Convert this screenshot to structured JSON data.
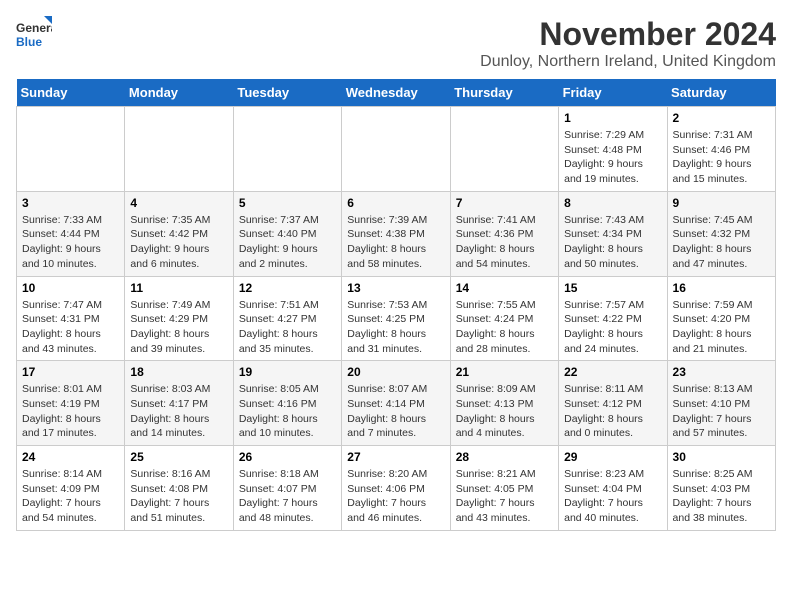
{
  "logo": {
    "general": "General",
    "blue": "Blue"
  },
  "title": {
    "month": "November 2024",
    "location": "Dunloy, Northern Ireland, United Kingdom"
  },
  "weekdays": [
    "Sunday",
    "Monday",
    "Tuesday",
    "Wednesday",
    "Thursday",
    "Friday",
    "Saturday"
  ],
  "weeks": [
    [
      {
        "date": "",
        "info": ""
      },
      {
        "date": "",
        "info": ""
      },
      {
        "date": "",
        "info": ""
      },
      {
        "date": "",
        "info": ""
      },
      {
        "date": "",
        "info": ""
      },
      {
        "date": "1",
        "info": "Sunrise: 7:29 AM\nSunset: 4:48 PM\nDaylight: 9 hours and 19 minutes."
      },
      {
        "date": "2",
        "info": "Sunrise: 7:31 AM\nSunset: 4:46 PM\nDaylight: 9 hours and 15 minutes."
      }
    ],
    [
      {
        "date": "3",
        "info": "Sunrise: 7:33 AM\nSunset: 4:44 PM\nDaylight: 9 hours and 10 minutes."
      },
      {
        "date": "4",
        "info": "Sunrise: 7:35 AM\nSunset: 4:42 PM\nDaylight: 9 hours and 6 minutes."
      },
      {
        "date": "5",
        "info": "Sunrise: 7:37 AM\nSunset: 4:40 PM\nDaylight: 9 hours and 2 minutes."
      },
      {
        "date": "6",
        "info": "Sunrise: 7:39 AM\nSunset: 4:38 PM\nDaylight: 8 hours and 58 minutes."
      },
      {
        "date": "7",
        "info": "Sunrise: 7:41 AM\nSunset: 4:36 PM\nDaylight: 8 hours and 54 minutes."
      },
      {
        "date": "8",
        "info": "Sunrise: 7:43 AM\nSunset: 4:34 PM\nDaylight: 8 hours and 50 minutes."
      },
      {
        "date": "9",
        "info": "Sunrise: 7:45 AM\nSunset: 4:32 PM\nDaylight: 8 hours and 47 minutes."
      }
    ],
    [
      {
        "date": "10",
        "info": "Sunrise: 7:47 AM\nSunset: 4:31 PM\nDaylight: 8 hours and 43 minutes."
      },
      {
        "date": "11",
        "info": "Sunrise: 7:49 AM\nSunset: 4:29 PM\nDaylight: 8 hours and 39 minutes."
      },
      {
        "date": "12",
        "info": "Sunrise: 7:51 AM\nSunset: 4:27 PM\nDaylight: 8 hours and 35 minutes."
      },
      {
        "date": "13",
        "info": "Sunrise: 7:53 AM\nSunset: 4:25 PM\nDaylight: 8 hours and 31 minutes."
      },
      {
        "date": "14",
        "info": "Sunrise: 7:55 AM\nSunset: 4:24 PM\nDaylight: 8 hours and 28 minutes."
      },
      {
        "date": "15",
        "info": "Sunrise: 7:57 AM\nSunset: 4:22 PM\nDaylight: 8 hours and 24 minutes."
      },
      {
        "date": "16",
        "info": "Sunrise: 7:59 AM\nSunset: 4:20 PM\nDaylight: 8 hours and 21 minutes."
      }
    ],
    [
      {
        "date": "17",
        "info": "Sunrise: 8:01 AM\nSunset: 4:19 PM\nDaylight: 8 hours and 17 minutes."
      },
      {
        "date": "18",
        "info": "Sunrise: 8:03 AM\nSunset: 4:17 PM\nDaylight: 8 hours and 14 minutes."
      },
      {
        "date": "19",
        "info": "Sunrise: 8:05 AM\nSunset: 4:16 PM\nDaylight: 8 hours and 10 minutes."
      },
      {
        "date": "20",
        "info": "Sunrise: 8:07 AM\nSunset: 4:14 PM\nDaylight: 8 hours and 7 minutes."
      },
      {
        "date": "21",
        "info": "Sunrise: 8:09 AM\nSunset: 4:13 PM\nDaylight: 8 hours and 4 minutes."
      },
      {
        "date": "22",
        "info": "Sunrise: 8:11 AM\nSunset: 4:12 PM\nDaylight: 8 hours and 0 minutes."
      },
      {
        "date": "23",
        "info": "Sunrise: 8:13 AM\nSunset: 4:10 PM\nDaylight: 7 hours and 57 minutes."
      }
    ],
    [
      {
        "date": "24",
        "info": "Sunrise: 8:14 AM\nSunset: 4:09 PM\nDaylight: 7 hours and 54 minutes."
      },
      {
        "date": "25",
        "info": "Sunrise: 8:16 AM\nSunset: 4:08 PM\nDaylight: 7 hours and 51 minutes."
      },
      {
        "date": "26",
        "info": "Sunrise: 8:18 AM\nSunset: 4:07 PM\nDaylight: 7 hours and 48 minutes."
      },
      {
        "date": "27",
        "info": "Sunrise: 8:20 AM\nSunset: 4:06 PM\nDaylight: 7 hours and 46 minutes."
      },
      {
        "date": "28",
        "info": "Sunrise: 8:21 AM\nSunset: 4:05 PM\nDaylight: 7 hours and 43 minutes."
      },
      {
        "date": "29",
        "info": "Sunrise: 8:23 AM\nSunset: 4:04 PM\nDaylight: 7 hours and 40 minutes."
      },
      {
        "date": "30",
        "info": "Sunrise: 8:25 AM\nSunset: 4:03 PM\nDaylight: 7 hours and 38 minutes."
      }
    ]
  ]
}
